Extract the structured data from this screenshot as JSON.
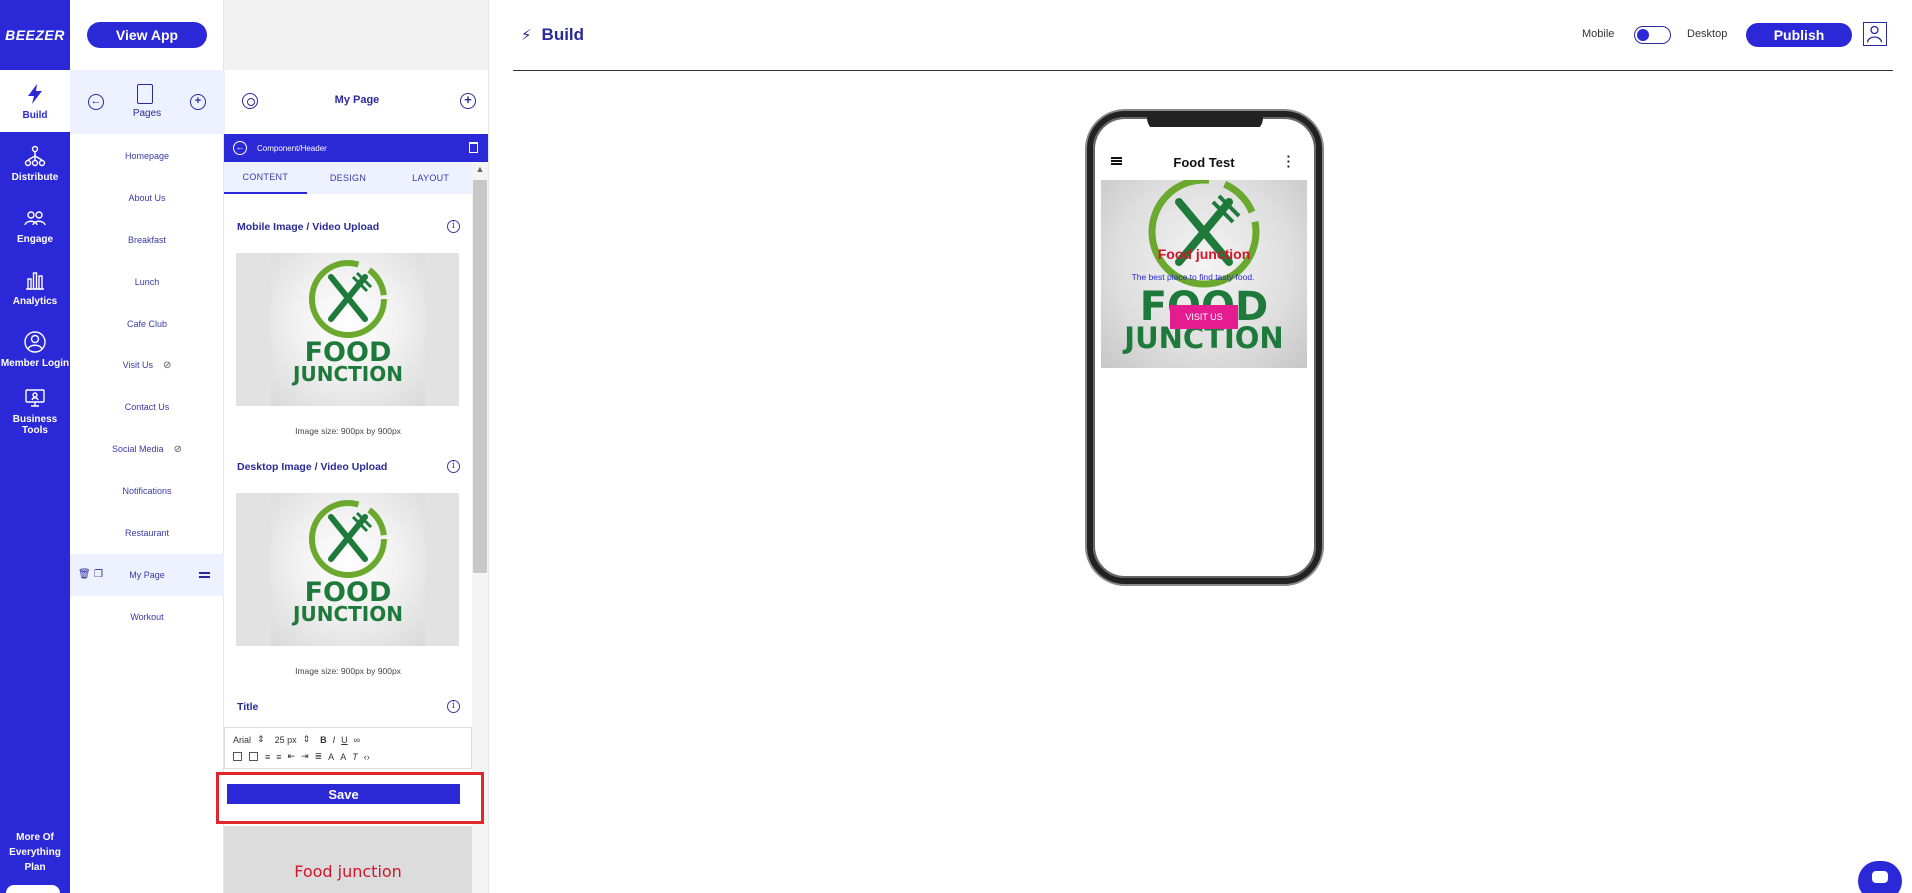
{
  "rail": {
    "logo": "BEEZER",
    "items": [
      {
        "label": "Build"
      },
      {
        "label": "Distribute"
      },
      {
        "label": "Engage"
      },
      {
        "label": "Analytics"
      },
      {
        "label": "Member Login"
      },
      {
        "label": "Business Tools"
      }
    ],
    "plan": "More Of Everything Plan"
  },
  "pages_panel": {
    "view_app": "View App",
    "header_label": "Pages",
    "items": [
      {
        "label": "Homepage"
      },
      {
        "label": "About Us"
      },
      {
        "label": "Breakfast"
      },
      {
        "label": "Lunch"
      },
      {
        "label": "Cafe Club"
      },
      {
        "label": "Visit Us"
      },
      {
        "label": "Contact Us"
      },
      {
        "label": "Social Media"
      },
      {
        "label": "Notifications"
      },
      {
        "label": "Restaurant"
      },
      {
        "label": "My Page"
      },
      {
        "label": "Workout"
      }
    ]
  },
  "editor": {
    "page_title": "My Page",
    "component_path": "Component/Header",
    "tabs": [
      "CONTENT",
      "DESIGN",
      "LAYOUT"
    ],
    "mobile_upload_title": "Mobile Image / Video Upload",
    "desktop_upload_title": "Desktop Image / Video Upload",
    "image_size_note": "Image size: 900px by 900px",
    "title_section": "Title",
    "font_family": "Arial",
    "font_size": "25 px",
    "save_label": "Save",
    "preview_text": "Food junction"
  },
  "main": {
    "title": "Build",
    "mobile_label": "Mobile",
    "desktop_label": "Desktop",
    "publish_label": "Publish"
  },
  "phone": {
    "app_title": "Food Test",
    "hero_title": "Food junction",
    "hero_subtitle": "The best place to find tasty food.",
    "hero_button": "VISIT US"
  },
  "logo_image": {
    "line1": "FOOD",
    "line2": "JUNCTION"
  },
  "colors": {
    "brand": "#2b28d8",
    "highlight": "#e0272f",
    "hero_button": "#e41c8f",
    "logo_green": "#1e7a3a",
    "logo_ring": "#6aa82e",
    "food_red": "#d0162a"
  }
}
